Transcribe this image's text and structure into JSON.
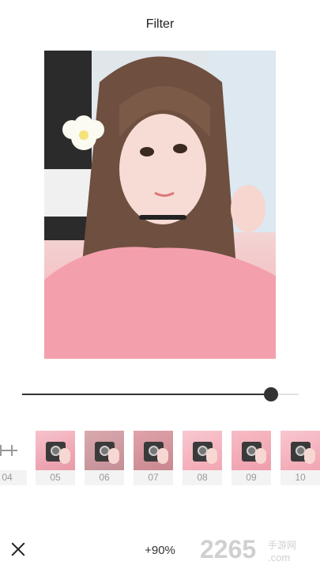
{
  "header": {
    "title": "Filter"
  },
  "slider": {
    "value_percent": 90
  },
  "filters": {
    "items": [
      {
        "label": "04",
        "style": "none"
      },
      {
        "label": "05",
        "style": "pink"
      },
      {
        "label": "06",
        "style": "dark"
      },
      {
        "label": "07",
        "style": "dark"
      },
      {
        "label": "08",
        "style": "pink"
      },
      {
        "label": "09",
        "style": "pink"
      },
      {
        "label": "10",
        "style": "pink"
      }
    ]
  },
  "footer": {
    "intensity_label": "+90%"
  },
  "watermark": {
    "text": "2265",
    "suffix": ".com",
    "cn": "手游网"
  },
  "icons": {
    "close": "close-icon",
    "photo": "photo-preview"
  },
  "colors": {
    "accent": "#333333",
    "track": "#e1e1e1",
    "pink": "#f5a8b0"
  }
}
